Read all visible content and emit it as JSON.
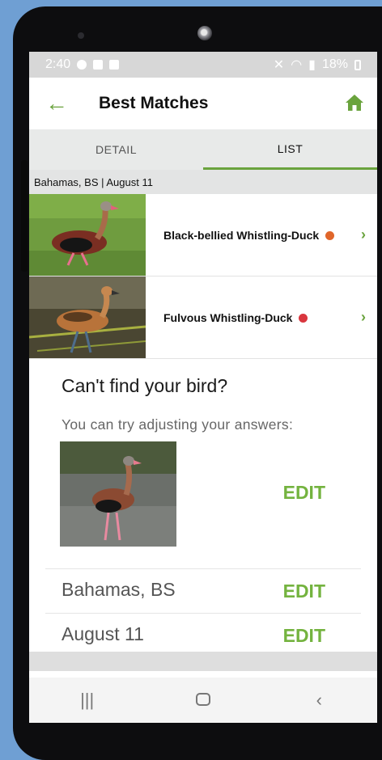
{
  "status_bar": {
    "time": "2:40",
    "battery": "18%"
  },
  "app_bar": {
    "title": "Best Matches",
    "back_icon": "arrow-left-icon",
    "home_icon": "home-icon"
  },
  "tabs": [
    {
      "label": "DETAIL",
      "active": false
    },
    {
      "label": "LIST",
      "active": true
    }
  ],
  "location_line": "Bahamas, BS | August 11",
  "results": [
    {
      "name": "Black-bellied Whistling-Duck",
      "marker_color": "#e0662a"
    },
    {
      "name": "Fulvous Whistling-Duck",
      "marker_color": "#d9363e"
    }
  ],
  "cant_find": {
    "heading": "Can't find your bird?",
    "subtext": "You can try adjusting your answers:",
    "edit_label": "EDIT",
    "rows": [
      {
        "value": "Bahamas, BS"
      },
      {
        "value": "August 11"
      }
    ]
  },
  "colors": {
    "accent": "#74b33f",
    "tab_indicator": "#6aa33d",
    "background": "#6f9fd3"
  },
  "nav_icons": [
    "recents-icon",
    "home-nav-icon",
    "back-nav-icon"
  ]
}
